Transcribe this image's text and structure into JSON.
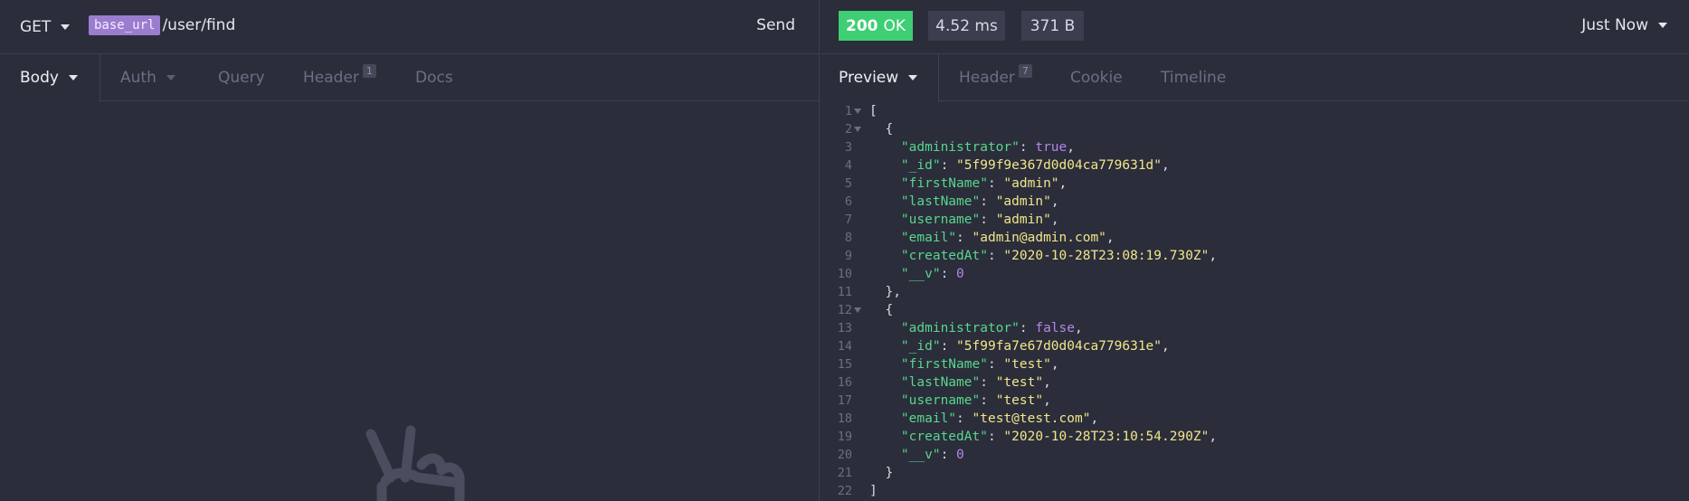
{
  "request": {
    "method": "GET",
    "url_variable": "base_url",
    "url_path": "/user/find",
    "send_label": "Send",
    "tabs": [
      {
        "label": "Body",
        "active": true,
        "has_dropdown": true
      },
      {
        "label": "Auth",
        "active": false,
        "has_dropdown": true
      },
      {
        "label": "Query",
        "active": false
      },
      {
        "label": "Header",
        "active": false,
        "badge": "1"
      },
      {
        "label": "Docs",
        "active": false
      }
    ]
  },
  "response": {
    "status_code": "200",
    "status_text": "OK",
    "time": "4.52 ms",
    "size": "371 B",
    "history_label": "Just Now",
    "tabs": [
      {
        "label": "Preview",
        "active": true,
        "has_dropdown": true
      },
      {
        "label": "Header",
        "active": false,
        "badge": "7"
      },
      {
        "label": "Cookie",
        "active": false
      },
      {
        "label": "Timeline",
        "active": false
      }
    ],
    "body_lines": [
      {
        "n": "1",
        "fold": true,
        "t": "["
      },
      {
        "n": "2",
        "fold": true,
        "t": "  {"
      },
      {
        "n": "3",
        "t": "    \"administrator\": true,"
      },
      {
        "n": "4",
        "t": "    \"_id\": \"5f99f9e367d0d04ca779631d\","
      },
      {
        "n": "5",
        "t": "    \"firstName\": \"admin\","
      },
      {
        "n": "6",
        "t": "    \"lastName\": \"admin\","
      },
      {
        "n": "7",
        "t": "    \"username\": \"admin\","
      },
      {
        "n": "8",
        "t": "    \"email\": \"admin@admin.com\","
      },
      {
        "n": "9",
        "t": "    \"createdAt\": \"2020-10-28T23:08:19.730Z\","
      },
      {
        "n": "10",
        "t": "    \"__v\": 0"
      },
      {
        "n": "11",
        "t": "  },"
      },
      {
        "n": "12",
        "fold": true,
        "t": "  {"
      },
      {
        "n": "13",
        "t": "    \"administrator\": false,"
      },
      {
        "n": "14",
        "t": "    \"_id\": \"5f99fa7e67d0d04ca779631e\","
      },
      {
        "n": "15",
        "t": "    \"firstName\": \"test\","
      },
      {
        "n": "16",
        "t": "    \"lastName\": \"test\","
      },
      {
        "n": "17",
        "t": "    \"username\": \"test\","
      },
      {
        "n": "18",
        "t": "    \"email\": \"test@test.com\","
      },
      {
        "n": "19",
        "t": "    \"createdAt\": \"2020-10-28T23:10:54.290Z\","
      },
      {
        "n": "20",
        "t": "    \"__v\": 0"
      },
      {
        "n": "21",
        "t": "  }"
      },
      {
        "n": "22",
        "t": "]"
      }
    ]
  },
  "colors": {
    "background": "#2b2d3a",
    "status_ok": "#3ece74",
    "variable_chip": "#9b7dcf",
    "json_key": "#58d68d",
    "json_string": "#f1e58a",
    "json_literal": "#b486ea"
  },
  "icons": {
    "empty_body": "peace-hand-icon"
  }
}
